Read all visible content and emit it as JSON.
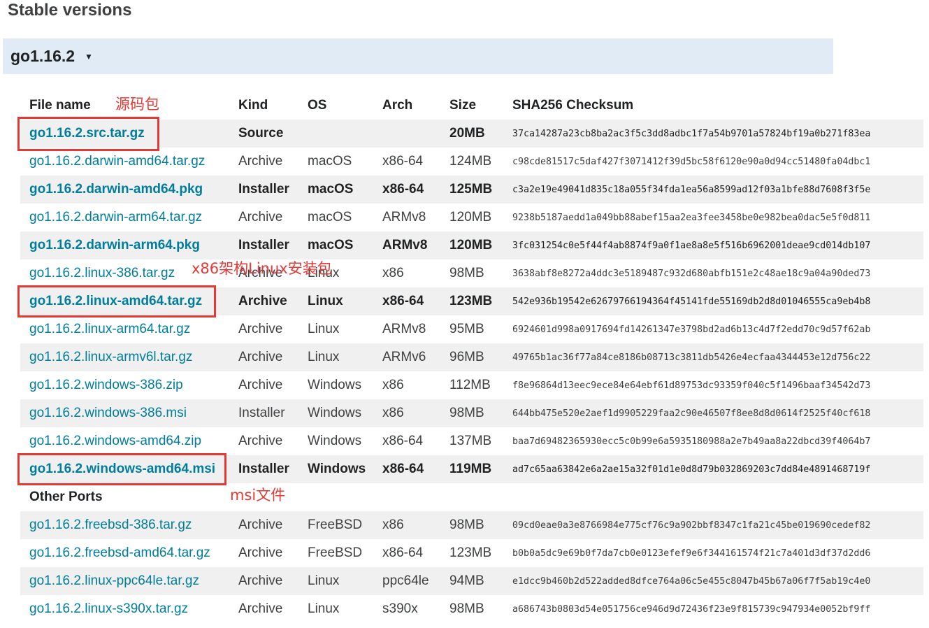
{
  "section_title": "Stable versions",
  "version": {
    "label": "go1.16.2",
    "caret": "▼"
  },
  "columns": [
    "File name",
    "Kind",
    "OS",
    "Arch",
    "Size",
    "SHA256 Checksum"
  ],
  "rows": [
    {
      "file": "go1.16.2.src.tar.gz",
      "kind": "Source",
      "os": "",
      "arch": "",
      "size": "20MB",
      "sha": "37ca14287a23cb8ba2ac3f5c3dd8adbc1f7a54b9701a57824bf19a0b271f83ea",
      "bold": true
    },
    {
      "file": "go1.16.2.darwin-amd64.tar.gz",
      "kind": "Archive",
      "os": "macOS",
      "arch": "x86-64",
      "size": "124MB",
      "sha": "c98cde81517c5daf427f3071412f39d5bc58f6120e90a0d94cc51480fa04dbc1",
      "bold": false
    },
    {
      "file": "go1.16.2.darwin-amd64.pkg",
      "kind": "Installer",
      "os": "macOS",
      "arch": "x86-64",
      "size": "125MB",
      "sha": "c3a2e19e49041d835c18a055f34fda1ea56a8599ad12f03a1bfe88d7608f3f5e",
      "bold": true
    },
    {
      "file": "go1.16.2.darwin-arm64.tar.gz",
      "kind": "Archive",
      "os": "macOS",
      "arch": "ARMv8",
      "size": "120MB",
      "sha": "9238b5187aedd1a049bb88abef15aa2ea3fee3458be0e982bea0dac5e5f0d811",
      "bold": false
    },
    {
      "file": "go1.16.2.darwin-arm64.pkg",
      "kind": "Installer",
      "os": "macOS",
      "arch": "ARMv8",
      "size": "120MB",
      "sha": "3fc031254c0e5f44f4ab8874f9a0f1ae8a8e5f516b6962001deae9cd014db107",
      "bold": true
    },
    {
      "file": "go1.16.2.linux-386.tar.gz",
      "kind": "Archive",
      "os": "Linux",
      "arch": "x86",
      "size": "98MB",
      "sha": "3638abf8e8272a4ddc3e5189487c932d680abfb151e2c48ae18c9a04a90ded73",
      "bold": false
    },
    {
      "file": "go1.16.2.linux-amd64.tar.gz",
      "kind": "Archive",
      "os": "Linux",
      "arch": "x86-64",
      "size": "123MB",
      "sha": "542e936b19542e62679766194364f45141fde55169db2d8d01046555ca9eb4b8",
      "bold": true
    },
    {
      "file": "go1.16.2.linux-arm64.tar.gz",
      "kind": "Archive",
      "os": "Linux",
      "arch": "ARMv8",
      "size": "95MB",
      "sha": "6924601d998a0917694fd14261347e3798bd2ad6b13c4d7f2edd70c9d57f62ab",
      "bold": false
    },
    {
      "file": "go1.16.2.linux-armv6l.tar.gz",
      "kind": "Archive",
      "os": "Linux",
      "arch": "ARMv6",
      "size": "96MB",
      "sha": "49765b1ac36f77a84ce8186b08713c3811db5426e4ecfaa4344453e12d756c22",
      "bold": false
    },
    {
      "file": "go1.16.2.windows-386.zip",
      "kind": "Archive",
      "os": "Windows",
      "arch": "x86",
      "size": "112MB",
      "sha": "f8e96864d13eec9ece84e64ebf61d89753dc93359f040c5f1496baaf34542d73",
      "bold": false
    },
    {
      "file": "go1.16.2.windows-386.msi",
      "kind": "Installer",
      "os": "Windows",
      "arch": "x86",
      "size": "98MB",
      "sha": "644bb475e520e2aef1d9905229faa2c90e46507f8ee8d8d0614f2525f40cf618",
      "bold": false
    },
    {
      "file": "go1.16.2.windows-amd64.zip",
      "kind": "Archive",
      "os": "Windows",
      "arch": "x86-64",
      "size": "137MB",
      "sha": "baa7d69482365930ecc5c0b99e6a5935180988a2e7b49aa8a22dbcd39f4064b7",
      "bold": false
    },
    {
      "file": "go1.16.2.windows-amd64.msi",
      "kind": "Installer",
      "os": "Windows",
      "arch": "x86-64",
      "size": "119MB",
      "sha": "ad7c65aa63842e6a2ae15a32f01d1e0d8d79b032869203c7dd84e4891468719f",
      "bold": true
    }
  ],
  "other_ports_label": "Other Ports",
  "other_rows": [
    {
      "file": "go1.16.2.freebsd-386.tar.gz",
      "kind": "Archive",
      "os": "FreeBSD",
      "arch": "x86",
      "size": "98MB",
      "sha": "09cd0eae0a3e8766984e775cf76c9a902bbf8347c1fa21c45be019690cedef82",
      "bold": false
    },
    {
      "file": "go1.16.2.freebsd-amd64.tar.gz",
      "kind": "Archive",
      "os": "FreeBSD",
      "arch": "x86-64",
      "size": "123MB",
      "sha": "b0b0a5dc9e69b0f7da7cb0e0123efef9e6f344161574f21c7a401d3df37d2dd6",
      "bold": false
    },
    {
      "file": "go1.16.2.linux-ppc64le.tar.gz",
      "kind": "Archive",
      "os": "Linux",
      "arch": "ppc64le",
      "size": "94MB",
      "sha": "e1dcc9b460b2d522added8dfce764a06c5e455c8047b45b67a06f7f5ab19c4e0",
      "bold": false
    },
    {
      "file": "go1.16.2.linux-s390x.tar.gz",
      "kind": "Archive",
      "os": "Linux",
      "arch": "s390x",
      "size": "98MB",
      "sha": "a686743b0803d54e051756ce946d9d72436f23e9f815739c947934e0052bf9ff",
      "bold": false
    }
  ],
  "annotations": {
    "source_pkg": "源码包",
    "linux_pkg": "x86架构Linux安装包",
    "msi_file": "msi文件"
  },
  "colors": {
    "link": "#007d9c",
    "annotation": "#e53935",
    "version_bar": "#e0ebf5",
    "row_stripe": "#f0f0f0"
  }
}
